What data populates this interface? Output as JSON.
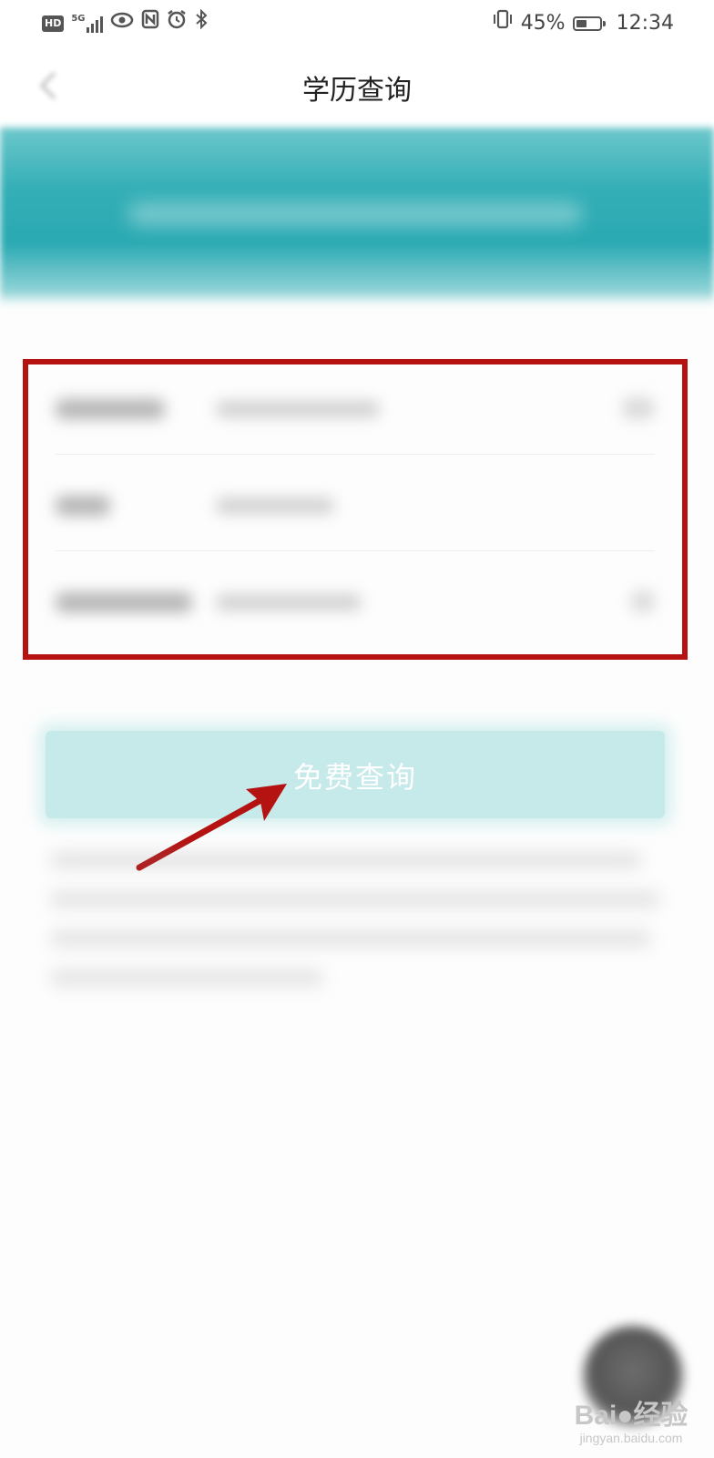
{
  "status_bar": {
    "badge": "HD",
    "network": "5G",
    "battery_percent": "45%",
    "battery_level": 0.45,
    "time": "12:34"
  },
  "header": {
    "title": "学历查询"
  },
  "form": {
    "highlight_color": "#b51212"
  },
  "query_button": {
    "label": "免费查询",
    "color": "#c6e9ea"
  },
  "annotation": {
    "arrow_color": "#b51212"
  },
  "watermark": {
    "main": "Bai●经验",
    "sub": "jingyan.baidu.com"
  },
  "colors": {
    "banner_teal": "#2aa9b2",
    "background": "#fdfdfd"
  }
}
